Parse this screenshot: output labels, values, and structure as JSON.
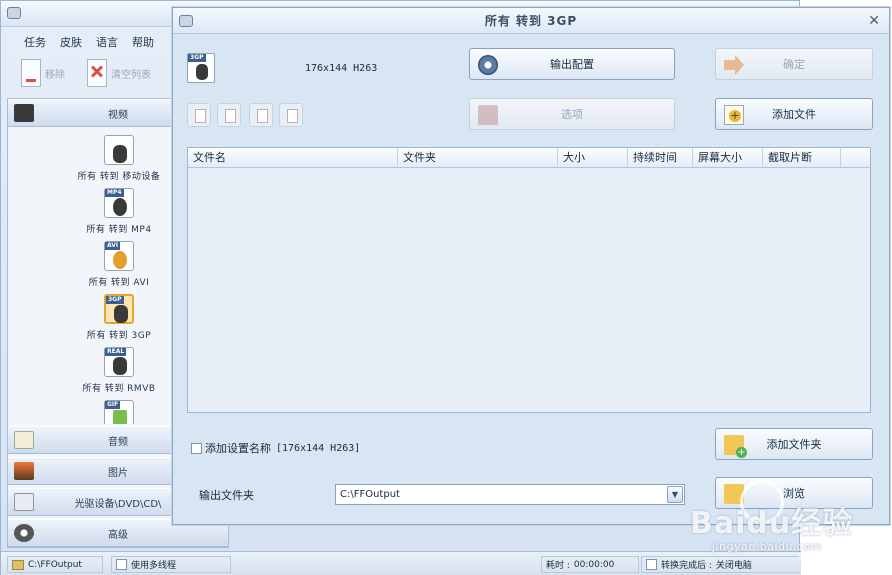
{
  "main": {
    "menu": [
      "任务",
      "皮肤",
      "语言",
      "帮助"
    ],
    "toolbar": {
      "remove": "移除",
      "clear_list": "清空列表"
    },
    "categories": {
      "video": "视频",
      "audio": "音频",
      "image": "图片",
      "disc": "光驱设备\\DVD\\CD\\",
      "advanced": "高级"
    },
    "conversions": [
      {
        "icon": "mobile-devices-icon",
        "tag": "",
        "label": "所有 转到 移动设备"
      },
      {
        "icon": "mp4-icon",
        "tag": "MP4",
        "label": "所有 转到 MP4"
      },
      {
        "icon": "avi-icon",
        "tag": "AVI",
        "label": "所有 转到 AVI"
      },
      {
        "icon": "3gp-icon",
        "tag": "3GP",
        "label": "所有 转到 3GP"
      },
      {
        "icon": "rmvb-icon",
        "tag": "REAL",
        "label": "所有 转到 RMVB"
      },
      {
        "icon": "gif-icon",
        "tag": "GIF",
        "label": ""
      }
    ],
    "selected_conversion": 3,
    "statusbar": {
      "path": "C:\\FFOutput",
      "multithread": "使用多线程",
      "elapsed_label": "耗时 : ",
      "elapsed": "00:00:00",
      "after_label": "转换完成后 : ",
      "after_action": "关闭电脑"
    }
  },
  "dialog": {
    "title": "所有 转到 3GP",
    "format_tag": "3GP",
    "format_spec": "176x144 H263",
    "buttons": {
      "output_config": "输出配置",
      "ok": "确定",
      "options": "选项",
      "add_file": "添加文件",
      "add_folder": "添加文件夹",
      "browse": "浏览"
    },
    "columns": [
      "文件名",
      "文件夹",
      "大小",
      "持续时间",
      "屏幕大小",
      "截取片断"
    ],
    "add_setting_name": "添加设置名称",
    "add_setting_spec": "[176x144 H263]",
    "output_folder_label": "输出文件夹",
    "output_folder_value": "C:\\FFOutput"
  },
  "watermark": {
    "logo": "Baidu经验",
    "url": "jingyan.baidu.com"
  },
  "colors": {
    "window_bg": "#d8e5f3",
    "border": "#8fa6c2",
    "selected": "#e8a332"
  }
}
